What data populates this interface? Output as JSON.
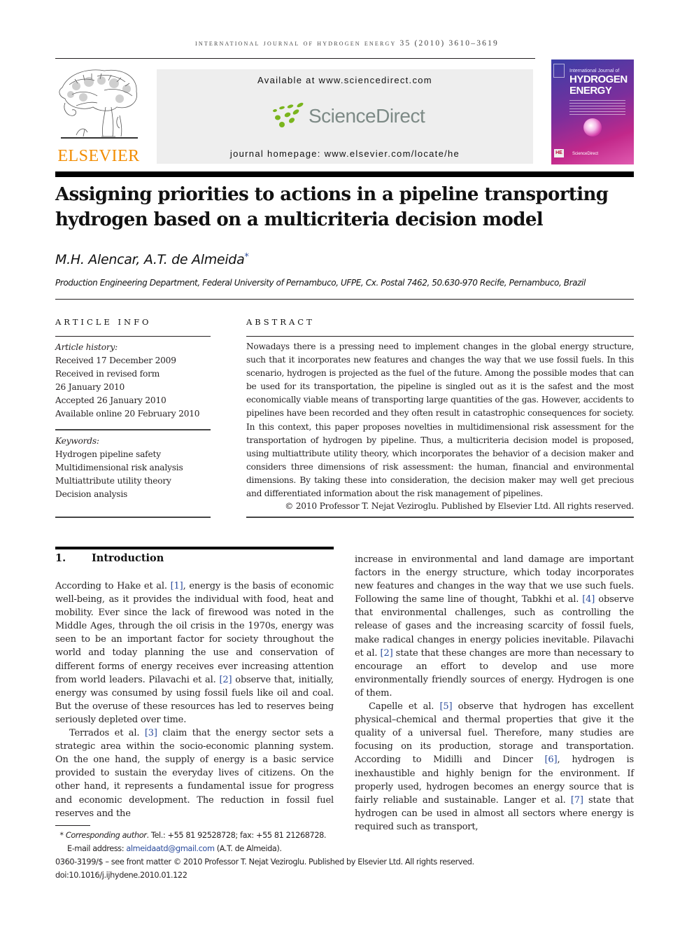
{
  "running_head": "International Journal of Hydrogen Energy 35 (2010) 3610–3619",
  "publisher": {
    "logo_text": "ELSEVIER",
    "logo_color": "#f28c00"
  },
  "sciencedirect": {
    "available_at": "Available at www.sciencedirect.com",
    "logo_text": "ScienceDirect",
    "logo_dot_color": "#7ab51d",
    "homepage": "journal homepage: www.elsevier.com/locate/he"
  },
  "cover": {
    "line1": "International Journal of",
    "line2": "HYDROGEN",
    "line3": "ENERGY",
    "badge": "HE",
    "footer": "ScienceDirect"
  },
  "article": {
    "title_line1": "Assigning priorities to actions in a pipeline transporting",
    "title_line2": "hydrogen based on a multicriteria decision model",
    "authors": "M.H. Alencar, A.T. de Almeida",
    "corresponding_mark": "*",
    "affiliation": "Production Engineering Department, Federal University of Pernambuco, UFPE, Cx. Postal 7462, 50.630-970 Recife, Pernambuco, Brazil"
  },
  "article_info": {
    "heading": "ARTICLE INFO",
    "history_label": "Article history:",
    "history": [
      "Received 17 December 2009",
      "Received in revised form",
      "26 January 2010",
      "Accepted 26 January 2010",
      "Available online 20 February 2010"
    ],
    "keywords_label": "Keywords:",
    "keywords": [
      "Hydrogen pipeline safety",
      "Multidimensional risk analysis",
      "Multiattribute utility theory",
      "Decision analysis"
    ]
  },
  "abstract": {
    "heading": "ABSTRACT",
    "text": "Nowadays there is a pressing need to implement changes in the global energy structure, such that it incorporates new features and changes the way that we use fossil fuels. In this scenario, hydrogen is projected as the fuel of the future. Among the possible modes that can be used for its transportation, the pipeline is singled out as it is the safest and the most economically viable means of transporting large quantities of the gas. However, accidents to pipelines have been recorded and they often result in catastrophic consequences for society. In this context, this paper proposes novelties in multidimensional risk assessment for the transportation of hydrogen by pipeline. Thus, a multicriteria decision model is proposed, using multiattribute utility theory, which incorporates the behavior of a decision maker and considers three dimensions of risk assessment: the human, financial and environmental dimensions. By taking these into consideration, the decision maker may well get precious and differentiated information about the risk management of pipelines.",
    "copyright": "© 2010 Professor T. Nejat Veziroglu. Published by Elsevier Ltd. All rights reserved."
  },
  "section1": {
    "number": "1.",
    "title": "Introduction",
    "left": {
      "p1_a": "According to Hake et al. ",
      "p1_ref1": "[1]",
      "p1_b": ", energy is the basis of economic well-being, as it provides the individual with food, heat and mobility. Ever since the lack of firewood was noted in the Middle Ages, through the oil crisis in the 1970s, energy was seen to be an important factor for society throughout the world and today planning the use and conservation of different forms of energy receives ever increasing attention from world leaders. Pilavachi et al. ",
      "p1_ref2": "[2]",
      "p1_c": " observe that, initially, energy was consumed by using fossil fuels like oil and coal. But the overuse of these resources has led to reserves being seriously depleted over time.",
      "p2_a": "Terrados et al. ",
      "p2_ref3": "[3]",
      "p2_b": " claim that the energy sector sets a strategic area within the socio-economic planning system. On the one hand, the supply of energy is a basic service provided to sustain the everyday lives of citizens. On the other hand, it represents a fundamental issue for progress and economic development. The reduction in fossil fuel reserves and the"
    },
    "right": {
      "p1_a": "increase in environmental and land damage are important factors in the energy structure, which today incorporates new features and changes in the way that we use such fuels. Following the same line of thought, Tabkhi et al. ",
      "p1_ref4": "[4]",
      "p1_b": " observe that environmental challenges, such as controlling the release of gases and the increasing scarcity of fossil fuels, make radical changes in energy policies inevitable. Pilavachi et al. ",
      "p1_ref2": "[2]",
      "p1_c": " state that these changes are more than necessary to encourage an effort to develop and use more environmentally friendly sources of energy. Hydrogen is one of them.",
      "p2_a": "Capelle et al. ",
      "p2_ref5": "[5]",
      "p2_b": " observe that hydrogen has excellent physical–chemical and thermal properties that give it the quality of a universal fuel. Therefore, many studies are focusing on its production, storage and transportation. According to Midilli and Dincer ",
      "p2_ref6": "[6]",
      "p2_c": ", hydrogen is inexhaustible and highly benign for the environment. If properly used, hydrogen becomes an energy source that is fairly reliable and sustainable. Langer et al. ",
      "p2_ref7": "[7]",
      "p2_d": " state that hydrogen can be used in almost all sectors where energy is required such as transport,"
    }
  },
  "footnotes": {
    "star": "*",
    "corresponding_label": "Corresponding author",
    "contact": ". Tel.: +55 81 92528728; fax: +55 81 21268728.",
    "email_label": "E-mail address: ",
    "email": "almeidaatd@gmail.com",
    "email_owner": " (A.T. de Almeida).",
    "front_matter": "0360-3199/$ – see front matter © 2010 Professor T. Nejat Veziroglu. Published by Elsevier Ltd. All rights reserved.",
    "doi": "doi:10.1016/j.ijhydene.2010.01.122"
  }
}
